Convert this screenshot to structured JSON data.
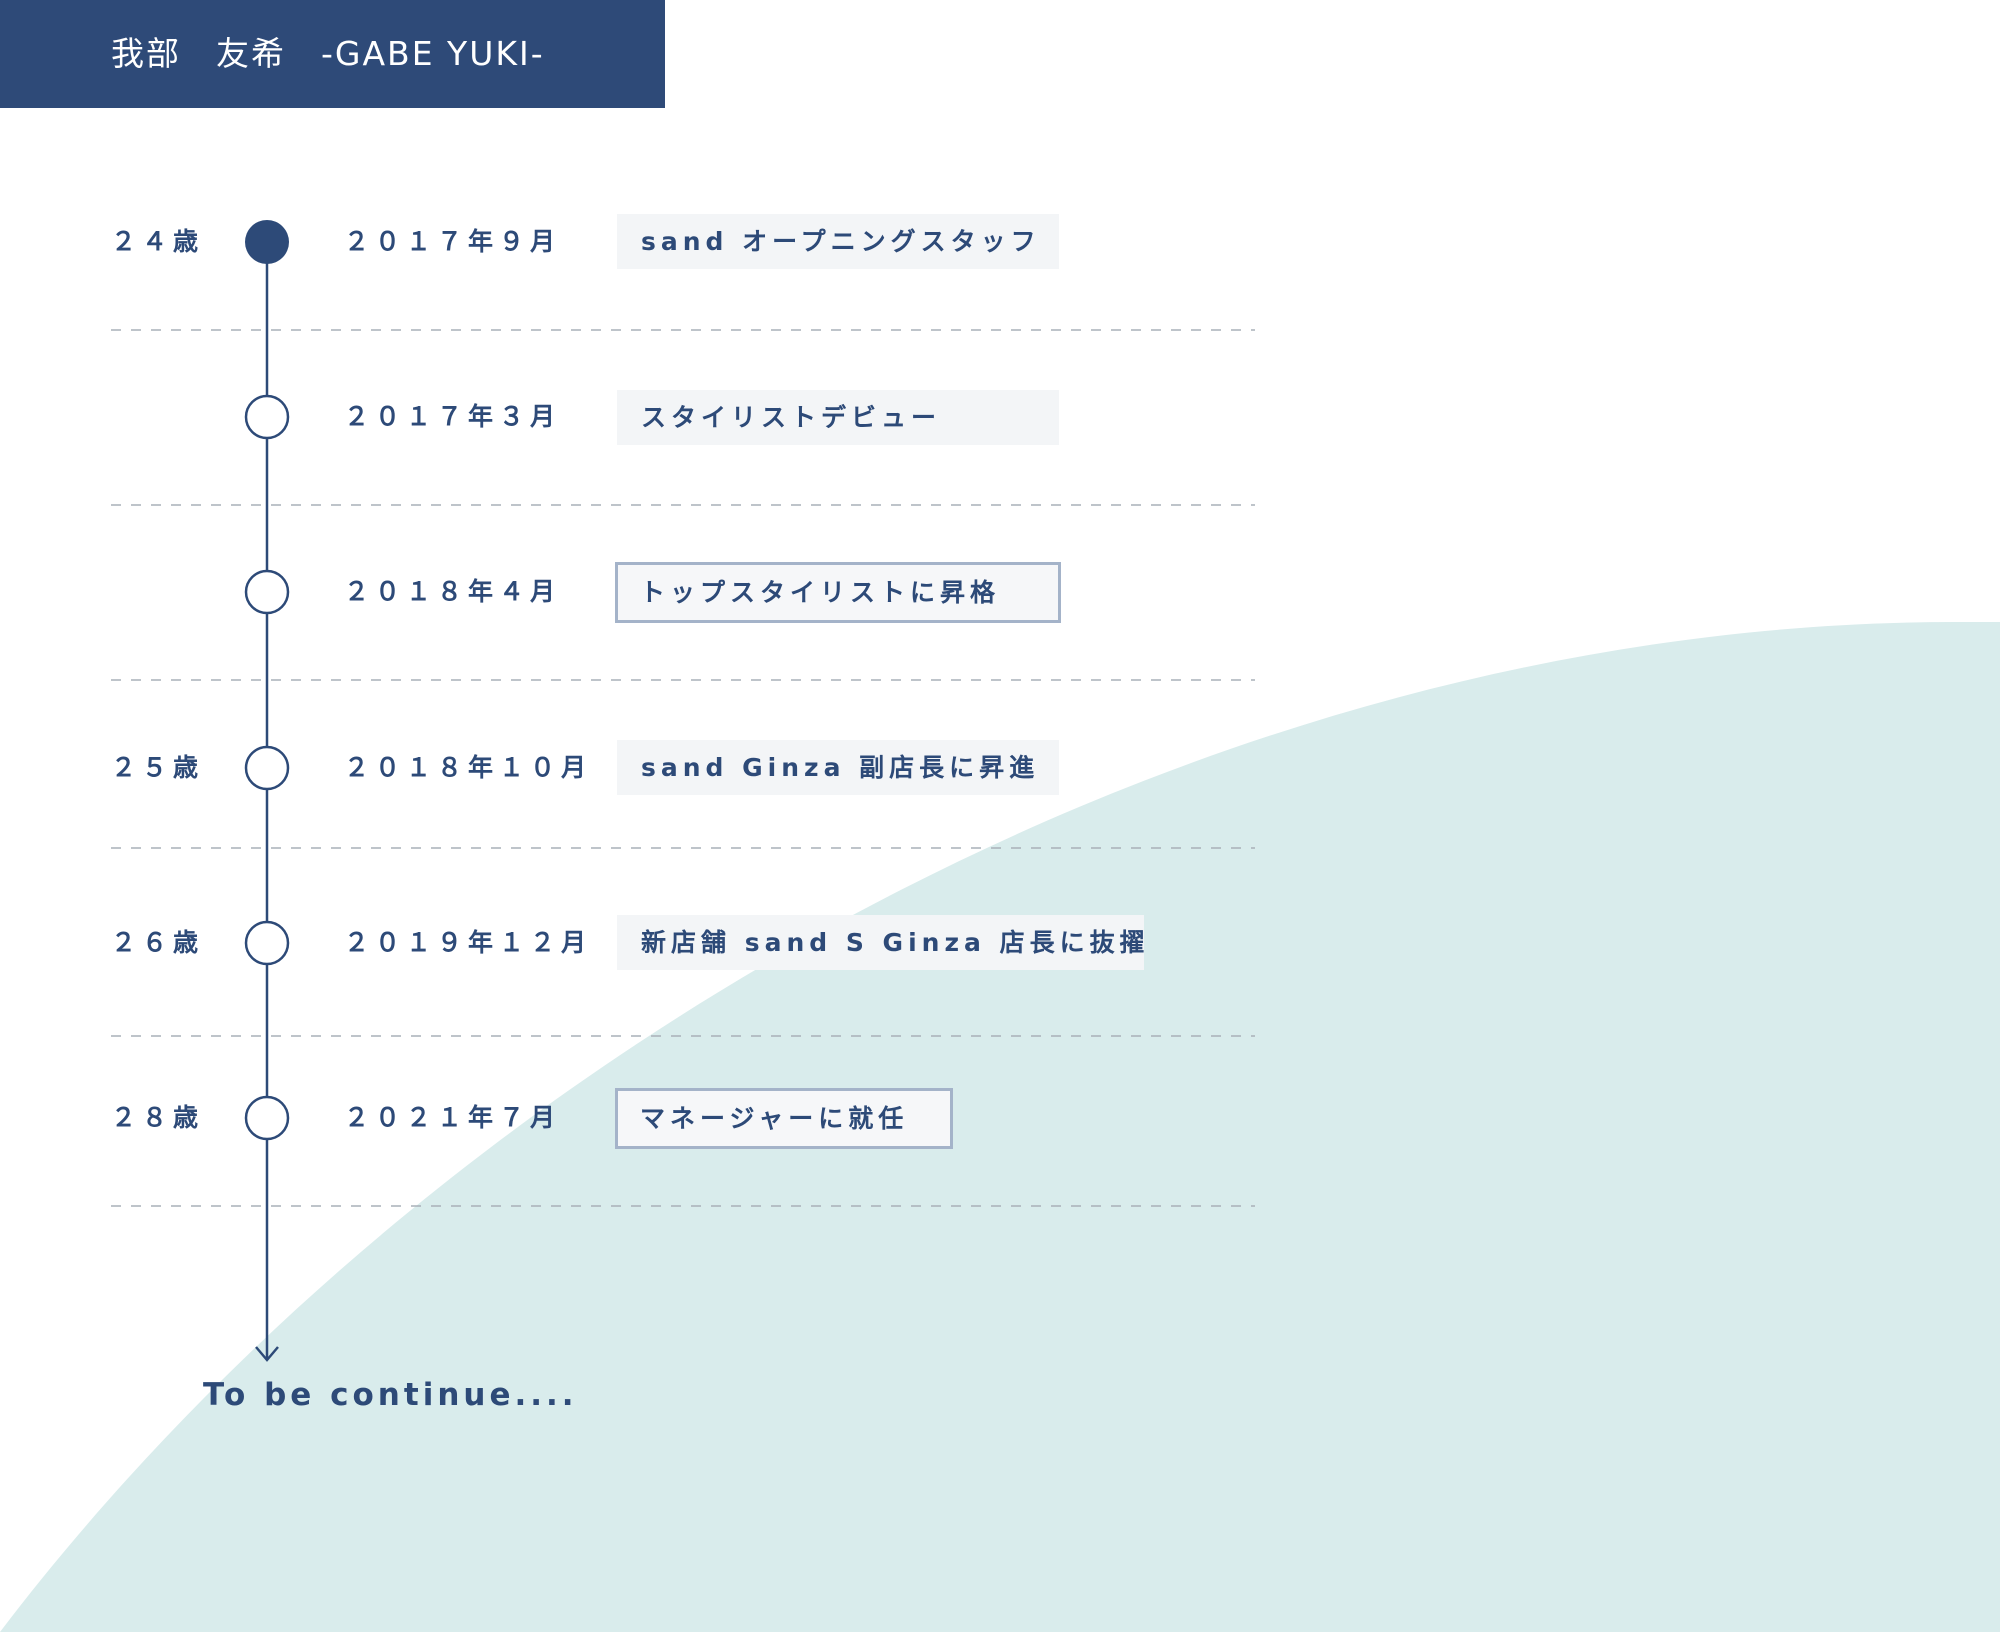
{
  "header": {
    "name": "我部　友希　-GABE YUKI-"
  },
  "colors": {
    "header_bg": "#2e4a78",
    "text": "#2d4a78",
    "wave": "#d9ecec",
    "badge_bg": "#f3f5f7",
    "badge_border": "#a4b3c9",
    "divider": "#a9b0b8"
  },
  "timeline": [
    {
      "age": "２４歳",
      "date": "２０１７年９月",
      "event": "sand オープニングスタッフ",
      "style": "filled",
      "dot": "filled"
    },
    {
      "age": "",
      "date": "２０１７年３月",
      "event": "スタイリストデビュー",
      "style": "filled",
      "dot": "hollow"
    },
    {
      "age": "",
      "date": "２０１８年４月",
      "event": "トップスタイリストに昇格",
      "style": "outlined",
      "dot": "hollow"
    },
    {
      "age": "２５歳",
      "date": "２０１８年１０月",
      "event": "sand Ginza 副店長に昇進",
      "style": "filled",
      "dot": "hollow"
    },
    {
      "age": "２６歳",
      "date": "２０１９年１２月",
      "event": "新店舗 sand S Ginza 店長に抜擢",
      "style": "filled",
      "dot": "hollow"
    },
    {
      "age": "２８歳",
      "date": "２０２１年７月",
      "event": "マネージャーに就任",
      "style": "outlined",
      "dot": "hollow"
    }
  ],
  "footer": {
    "continue_text": "To be continue...."
  }
}
